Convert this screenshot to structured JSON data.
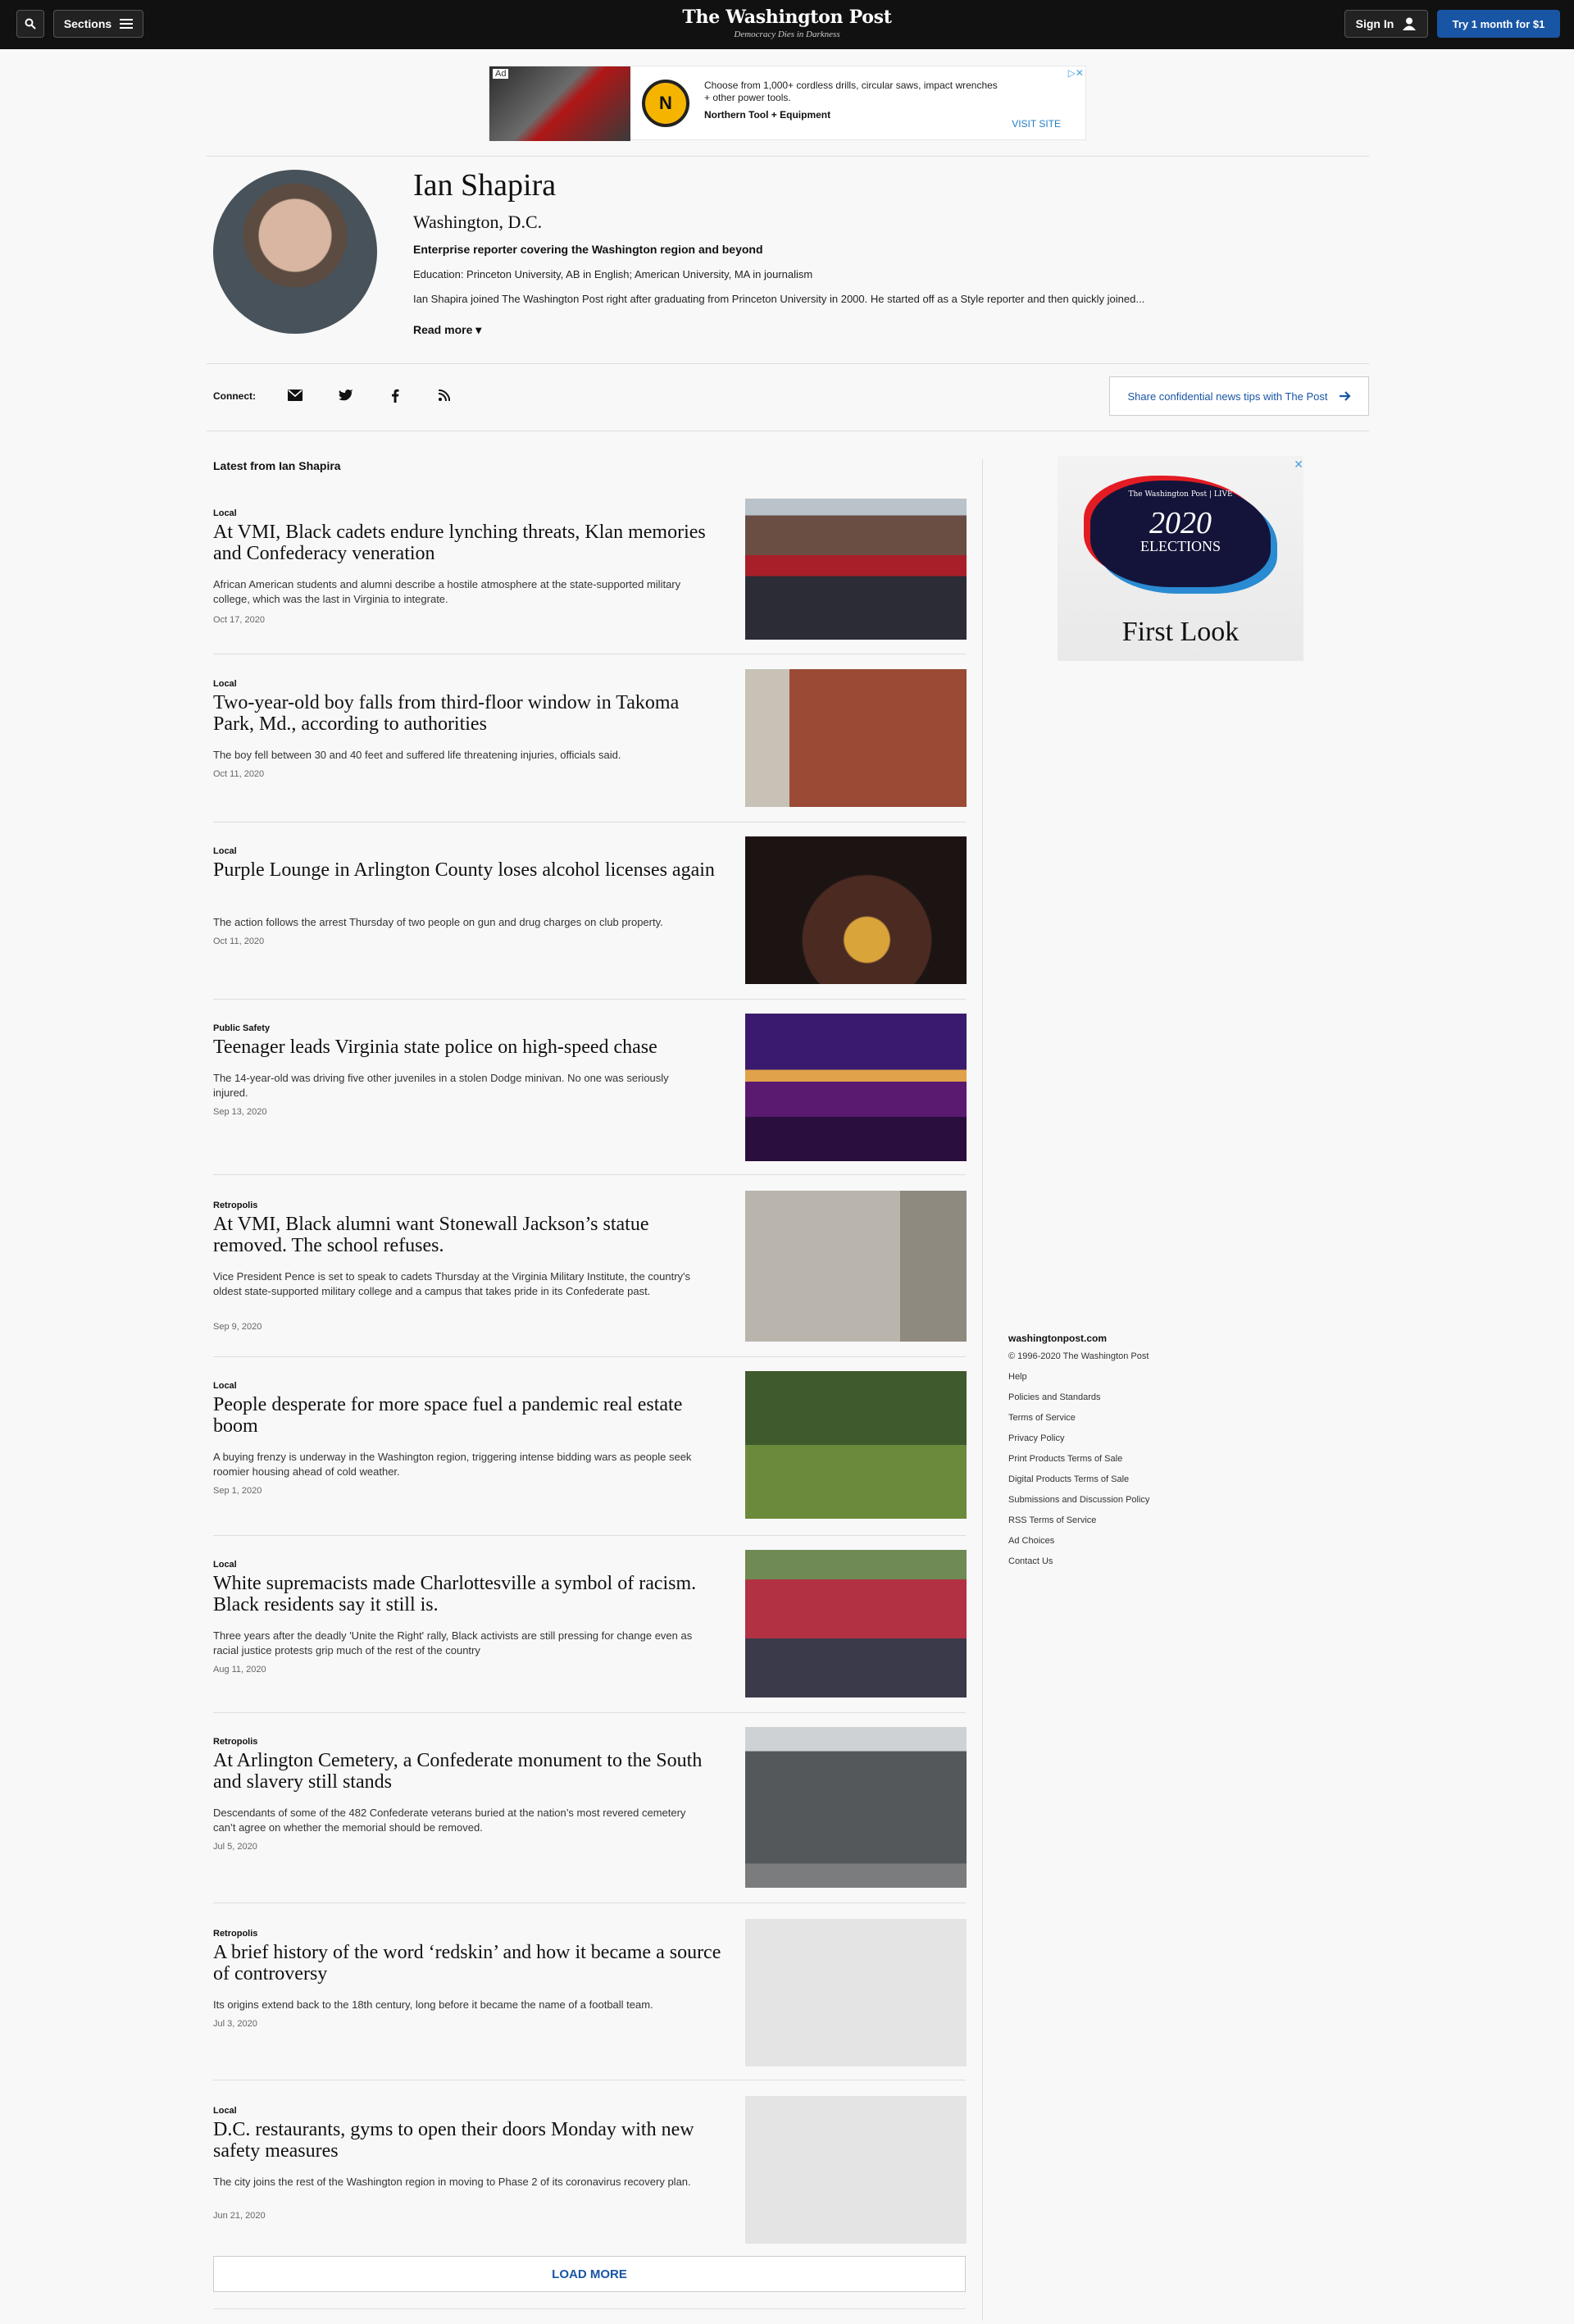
{
  "header": {
    "sections_label": "Sections",
    "logo": "The Washington Post",
    "tagline": "Democracy Dies in Darkness",
    "signin_label": "Sign In",
    "subscribe_label": "Try 1 month for $1"
  },
  "top_ad": {
    "label": "Ad",
    "text": "Choose from 1,000+ cordless drills, circular saws, impact wrenches + other power tools.",
    "brand": "Northern Tool + Equipment",
    "cta": "VISIT SITE"
  },
  "profile": {
    "name": "Ian Shapira",
    "location": "Washington, D.C.",
    "role": "Enterprise reporter covering the Washington region and beyond",
    "education": "Education: Princeton University, AB in English; American University, MA in journalism",
    "bio": "Ian Shapira joined The Washington Post right after graduating from Princeton University in 2000. He started off as a Style reporter and then quickly joined...",
    "read_more": "Read more"
  },
  "connect": {
    "label": "Connect:",
    "tips": "Share confidential news tips with The Post"
  },
  "latest_heading": "Latest from Ian Shapira",
  "articles": [
    {
      "kicker": "Local",
      "hed": "At VMI, Black cadets endure lynching threats, Klan memories and Confederacy veneration",
      "dek": "African American students and alumni describe a hostile atmosphere at the state-supported military college, which was the last in Virginia to integrate.",
      "date": "Oct 17, 2020"
    },
    {
      "kicker": "Local",
      "hed": "Two-year-old boy falls from third-floor window in Takoma Park, Md., according to authorities",
      "dek": "The boy fell between 30 and 40 feet and suffered life threatening injuries, officials said.",
      "date": "Oct 11, 2020"
    },
    {
      "kicker": "Local",
      "hed": "Purple Lounge in Arlington County loses alcohol licenses again",
      "dek": "The action follows the arrest Thursday of two people on gun and drug charges on club property.",
      "date": "Oct 11, 2020"
    },
    {
      "kicker": "Public Safety",
      "hed": "Teenager leads Virginia state police on high-speed chase",
      "dek": "The 14-year-old was driving five other juveniles in a stolen Dodge minivan. No one was seriously injured.",
      "date": "Sep 13, 2020"
    },
    {
      "kicker": "Retropolis",
      "hed": "At VMI, Black alumni want Stonewall Jackson’s statue removed. The school refuses.",
      "dek": "Vice President Pence is set to speak to cadets Thursday at the Virginia Military Institute, the country's oldest state-supported military college and a campus that takes pride in its Confederate past.",
      "date": "Sep 9, 2020"
    },
    {
      "kicker": "Local",
      "hed": "People desperate for more space fuel a pandemic real estate boom",
      "dek": "A buying frenzy is underway in the Washington region, triggering intense bidding wars as people seek roomier housing ahead of cold weather.",
      "date": "Sep 1, 2020"
    },
    {
      "kicker": "Local",
      "hed": "White supremacists made Charlottesville a symbol of racism. Black residents say it still is.",
      "dek": "Three years after the deadly 'Unite the Right' rally, Black activists are still pressing for change even as racial justice protests grip much of the rest of the country",
      "date": "Aug 11, 2020"
    },
    {
      "kicker": "Retropolis",
      "hed": "At Arlington Cemetery, a Confederate monument to the South and slavery still stands",
      "dek": "Descendants of some of the 482 Confederate veterans buried at the nation’s most revered cemetery can’t agree on whether the memorial should be removed.",
      "date": "Jul 5, 2020"
    },
    {
      "kicker": "Retropolis",
      "hed": "A brief history of the word ‘redskin’ and how it became a source of controversy",
      "dek": "Its origins extend back to the 18th century, long before it became the name of a football team.",
      "date": "Jul 3, 2020"
    },
    {
      "kicker": "Local",
      "hed": "D.C. restaurants, gyms to open their doors Monday with new safety measures",
      "dek": "The city joins the rest of the Washington region in moving to Phase 2 of its coronavirus recovery plan.",
      "date": "Jun 21, 2020"
    }
  ],
  "load_more": "LOAD MORE",
  "side_ad": {
    "masthead": "The Washington Post | LIVE",
    "year": "2020",
    "elections": "ELECTIONS",
    "first_look": "First Look"
  },
  "footer": {
    "site": "washingtonpost.com",
    "links": [
      "© 1996-2020 The Washington Post",
      "Help",
      "Policies and Standards",
      "Terms of Service",
      "Privacy Policy",
      "Print Products Terms of Sale",
      "Digital Products Terms of Sale",
      "Submissions and Discussion Policy",
      "RSS Terms of Service",
      "Ad Choices",
      "Contact Us"
    ]
  },
  "colors": {
    "topbar": "#111111",
    "accent_blue": "#1955a5",
    "background": "#f8f8f8"
  }
}
